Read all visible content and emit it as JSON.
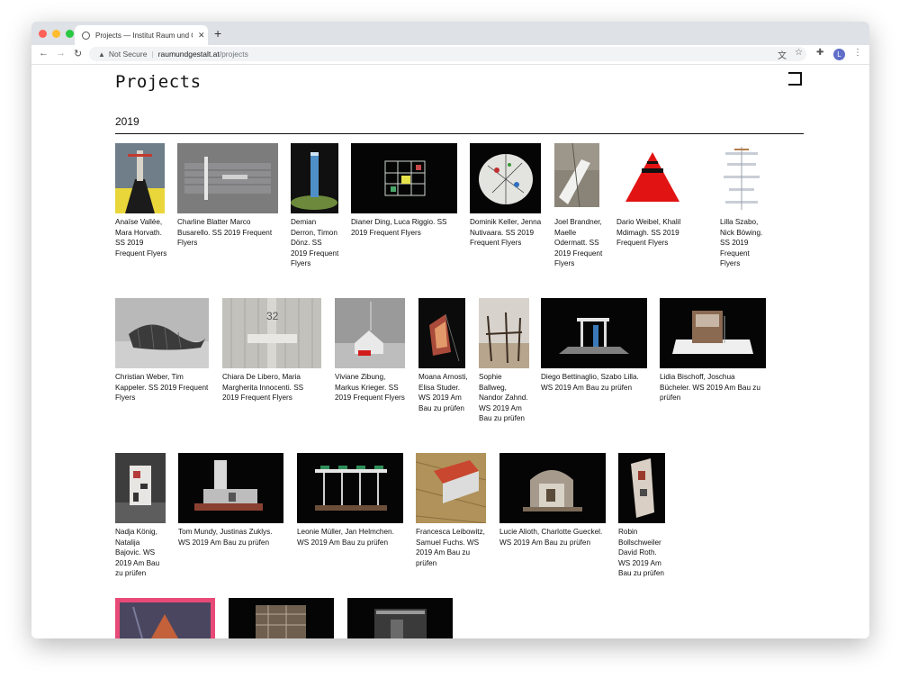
{
  "browser": {
    "tab_title": "Projects — Institut Raum und G",
    "tab_close": "✕",
    "new_tab": "+",
    "security_label": "Not Secure",
    "url_host": "raumundgestalt.at",
    "url_path": "/projects",
    "avatar_letter": "L"
  },
  "page": {
    "title": "Projects",
    "year": "2019"
  },
  "projects": [
    {
      "caption": "Anaïse Vallée, Mara Horvath. SS 2019 Frequent Flyers"
    },
    {
      "caption": "Charline Blatter Marco Busarello. SS 2019 Frequent Flyers"
    },
    {
      "caption": "Demian Derron, Timon Dönz. SS 2019 Frequent Flyers"
    },
    {
      "caption": "Dianer Ding, Luca Riggio. SS 2019 Frequent Flyers"
    },
    {
      "caption": "Dominik Keller, Jenna Nutivaara. SS 2019 Frequent Flyers"
    },
    {
      "caption": "Joel Brandner, Maelle Odermatt. SS 2019 Frequent Flyers"
    },
    {
      "caption": "Dario Weibel, Khalil Mdimagh. SS 2019 Frequent Flyers"
    },
    {
      "caption": "Lilla Szabo, Nick Böwing. SS 2019 Frequent Flyers"
    },
    {
      "caption": "Christian Weber, Tim Kappeler. SS 2019 Frequent Flyers"
    },
    {
      "caption": "Chiara De Libero, Maria Margherita Innocenti. SS 2019 Frequent Flyers"
    },
    {
      "caption": "Viviane Zibung, Markus Krieger. SS 2019 Frequent Flyers"
    },
    {
      "caption": "Moana Arnosti, Elisa Studer. WS 2019 Am Bau zu prüfen"
    },
    {
      "caption": "Sophie Ballweg, Nandor Zahnd. WS 2019 Am Bau zu prüfen"
    },
    {
      "caption": "Diego Bettinaglio, Szabo Lilla. WS 2019 Am Bau zu prüfen"
    },
    {
      "caption": "Lidia Bischoff, Joschua Bücheler. WS 2019 Am Bau zu prüfen"
    },
    {
      "caption": "Nadja König, Natalija Bajovic. WS 2019 Am Bau zu prüfen"
    },
    {
      "caption": "Tom Mundy, Justinas Zuklys. WS 2019 Am Bau zu prüfen"
    },
    {
      "caption": "Leonie Müller, Jan Helmchen. WS 2019 Am Bau zu prüfen"
    },
    {
      "caption": "Francesca Leibowitz, Samuel Fuchs. WS 2019 Am Bau zu prüfen"
    },
    {
      "caption": "Lucie Alioth, Charlotte Gueckel. WS 2019 Am Bau zu prüfen"
    },
    {
      "caption": "Robin Bollschweiler David Roth. WS 2019 Am Bau zu prüfen"
    },
    {
      "caption": ""
    },
    {
      "caption": ""
    },
    {
      "caption": ""
    }
  ]
}
